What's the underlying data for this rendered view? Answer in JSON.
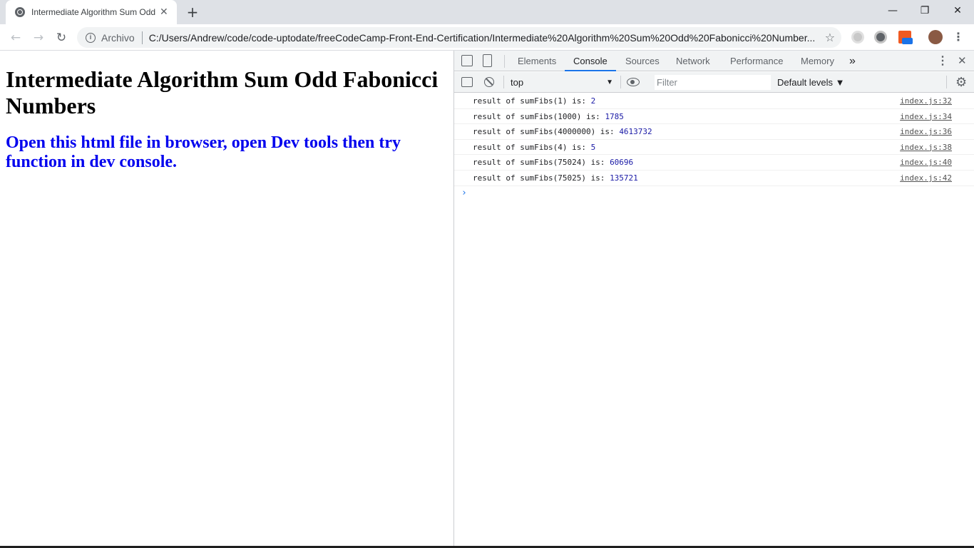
{
  "browser": {
    "tab": {
      "title": "Intermediate Algorithm Sum Odd Fabonicci Numbers",
      "close": "✕"
    },
    "new_tab": "+",
    "window_controls": {
      "minimize": "—",
      "restore": "❐",
      "close": "✕"
    },
    "nav": {
      "back": "←",
      "forward": "→",
      "reload": "↻"
    },
    "omnibox": {
      "info": "i",
      "scheme": "Archivo",
      "url": "C:/Users/Andrew/code/code-uptodate/freeCodeCamp-Front-End-Certification/Intermediate%20Algorithm%20Sum%20Odd%20Fabonicci%20Number...",
      "star": "☆"
    },
    "menu": "⋮"
  },
  "page": {
    "heading": "Intermediate Algorithm Sum Odd Fabonicci Numbers",
    "subheading": "Open this html file in browser, open Dev tools then try function in dev console."
  },
  "devtools": {
    "tabs": [
      {
        "label": "Elements"
      },
      {
        "label": "Console"
      },
      {
        "label": "Sources"
      },
      {
        "label": "Network"
      },
      {
        "label": "Performance"
      },
      {
        "label": "Memory"
      }
    ],
    "more_tabs": "»",
    "kebab": "⋮",
    "close": "✕",
    "toolbar": {
      "context": "top",
      "context_arrow": "▼",
      "filter_placeholder": "Filter",
      "levels": "Default levels ▼"
    },
    "logs": [
      {
        "message": "result of sumFibs(1) is: ",
        "value": "2",
        "source": "index.js:32"
      },
      {
        "message": "result of sumFibs(1000) is: ",
        "value": "1785",
        "source": "index.js:34"
      },
      {
        "message": "result of sumFibs(4000000) is: ",
        "value": "4613732",
        "source": "index.js:36"
      },
      {
        "message": "result of sumFibs(4) is: ",
        "value": "5",
        "source": "index.js:38"
      },
      {
        "message": "result of sumFibs(75024) is: ",
        "value": "60696",
        "source": "index.js:40"
      },
      {
        "message": "result of sumFibs(75025) is: ",
        "value": "135721",
        "source": "index.js:42"
      }
    ],
    "prompt": "›"
  },
  "colors": {
    "accent": "#1a73e8",
    "link_blue": "#0000ee",
    "console_number": "#1a1aa6"
  }
}
